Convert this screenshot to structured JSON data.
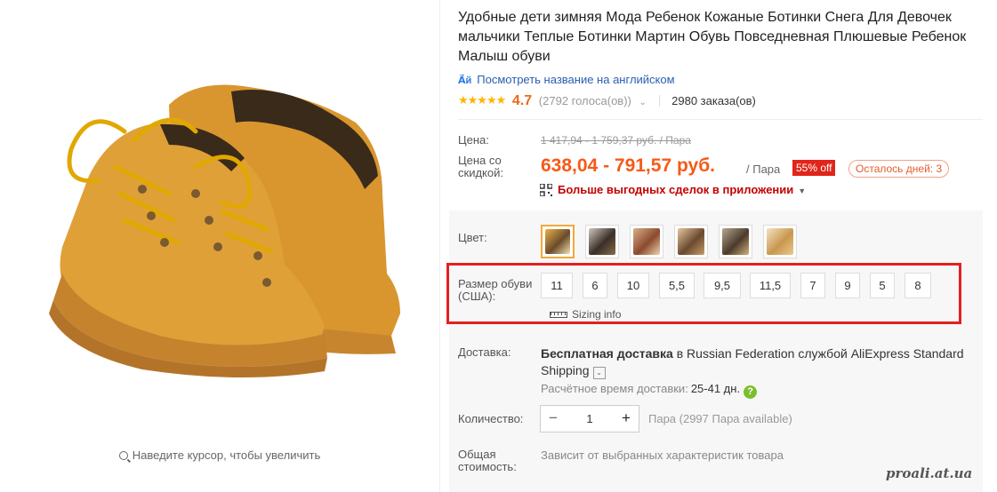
{
  "product": {
    "title": "Удобные дети зимняя Мода Ребенок Кожаные Ботинки Снега Для Девочек мальчики Теплые Ботинки Мартин Обувь Повседневная Плюшевые Ребенок Малыш обуви",
    "translate_icon": "translate-icon",
    "translate_label": "Посмотреть название на английском",
    "stars": "★★★★★",
    "rating": "4.7",
    "votes": "(2792 голоса(ов))",
    "orders": "2980 заказа(ов)"
  },
  "price": {
    "label": "Цена:",
    "old": "1 417,94 - 1 759,37 руб. / Пара",
    "discount_label": "Цена со скидкой:",
    "new": "638,04 - 791,57 руб.",
    "unit": "/ Пара",
    "discount_badge": "55% off",
    "days_left": "Осталось дней: 3",
    "app_deal": "Больше выгодных сделок в приложении",
    "accent_color": "#f65a18"
  },
  "color": {
    "label": "Цвет:",
    "swatches": [
      "swatch-1",
      "swatch-2",
      "swatch-3",
      "swatch-4",
      "swatch-5",
      "swatch-6"
    ],
    "selected_index": 0
  },
  "size": {
    "label": "Размер обуви (США):",
    "options": [
      "11",
      "6",
      "10",
      "5,5",
      "9,5",
      "11,5",
      "7",
      "9",
      "5",
      "8"
    ],
    "sizing_info": "Sizing info"
  },
  "shipping": {
    "label": "Доставка:",
    "free": "Бесплатная доставка",
    "rest": " в Russian Federation службой AliExpress Standard Shipping",
    "eta_label": "Расчётное время доставки:",
    "eta_value": "25-41 дн.",
    "help": "?"
  },
  "quantity": {
    "label": "Количество:",
    "minus": "−",
    "value": "1",
    "plus": "+",
    "available": "Пара (2997 Пара available)"
  },
  "total": {
    "label": "Общая стоимость:",
    "note": "Зависит от выбранных характеристик товара"
  },
  "image": {
    "zoom_hint": "Наведите курсор, чтобы увеличить"
  },
  "watermark": "proali.at.ua"
}
